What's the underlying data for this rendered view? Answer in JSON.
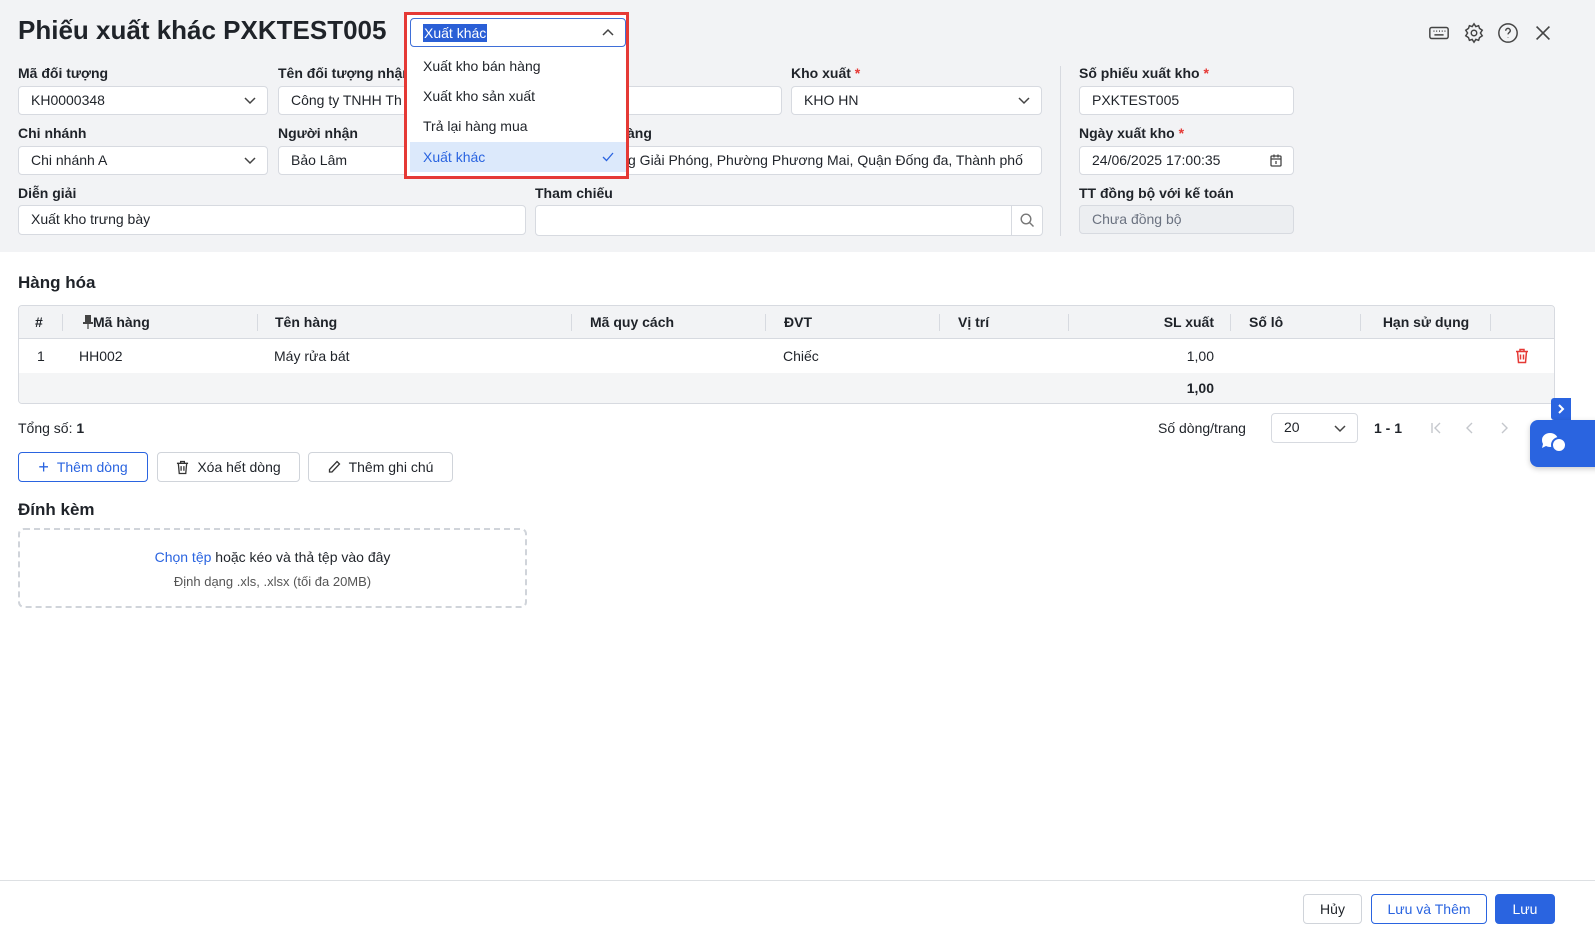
{
  "header": {
    "title": "Phiếu xuất khác PXKTEST005",
    "icons": [
      "keyboard-icon",
      "gear-icon",
      "help-icon",
      "close-icon"
    ]
  },
  "type_select": {
    "value": "Xuất khác",
    "options": [
      "Xuất kho bán hàng",
      "Xuất kho sản xuất",
      "Trả lại hàng mua",
      "Xuất khác"
    ],
    "selected_index": 3
  },
  "form": {
    "ma_doi_tuong": {
      "label": "Mã đối tượng",
      "value": "KH0000348"
    },
    "ten_doi_tuong": {
      "label": "Tên đối tượng nhận",
      "value": "Công ty TNHH Th"
    },
    "kho_xuat": {
      "label": "Kho xuất",
      "value": "KHO HN"
    },
    "chi_nhanh": {
      "label": "Chi nhánh",
      "value": "Chi nhánh A"
    },
    "nguoi_nhan": {
      "label": "Người nhận",
      "value": "Bảo Lâm"
    },
    "dia_chi": {
      "label": "àng",
      "value": "g Giải Phóng, Phường Phương Mai, Quận Đống đa, Thành phố"
    },
    "dien_giai": {
      "label": "Diễn giải",
      "value": "Xuất kho trưng bày"
    },
    "tham_chieu": {
      "label": "Tham chiếu",
      "value": ""
    },
    "so_phieu": {
      "label": "Số phiếu xuất kho",
      "value": "PXKTEST005"
    },
    "ngay_xuat": {
      "label": "Ngày xuất kho",
      "value": "24/06/2025 17:00:35"
    },
    "tt_dong_bo": {
      "label": "TT đồng bộ với kế toán",
      "value": "Chưa đồng bộ"
    },
    "required_mark": "*"
  },
  "goods": {
    "title": "Hàng hóa",
    "columns": [
      "#",
      "Mã hàng",
      "Tên hàng",
      "Mã quy cách",
      "ĐVT",
      "Vị trí",
      "SL xuất",
      "Số lô",
      "Hạn sử dụng"
    ],
    "rows": [
      {
        "no": "1",
        "code": "HH002",
        "name": "Máy rửa bát",
        "spec": "",
        "unit": "Chiếc",
        "location": "",
        "qty": "1,00",
        "lot": "",
        "expiry": ""
      }
    ],
    "total_qty": "1,00",
    "count_label": "Tổng số:",
    "count": "1",
    "page_size_label": "Số dòng/trang",
    "page_size": "20",
    "range": "1 - 1"
  },
  "actions": {
    "add_row": "Thêm dòng",
    "delete_all": "Xóa hết dòng",
    "add_note": "Thêm ghi chú"
  },
  "attach": {
    "title": "Đính kèm",
    "choose": "Chọn tệp",
    "drag": " hoặc kéo và thả tệp vào đây",
    "format": "Định dạng .xls, .xlsx (tối đa 20MB)"
  },
  "footer": {
    "cancel": "Hủy",
    "save_add": "Lưu và Thêm",
    "save": "Lưu"
  },
  "colors": {
    "accent": "#2a64e0",
    "danger": "#e53935"
  }
}
